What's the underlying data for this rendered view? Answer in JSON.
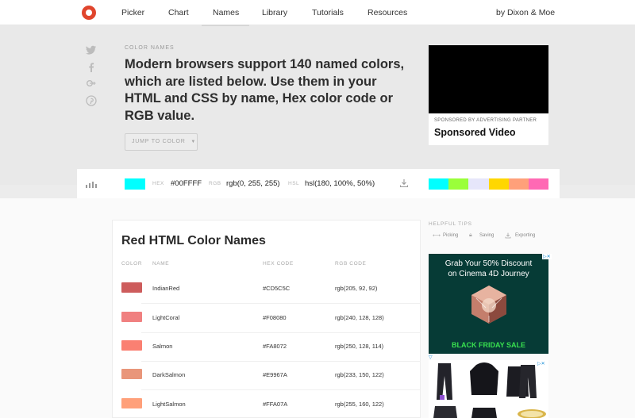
{
  "nav": {
    "items": [
      "Picker",
      "Chart",
      "Names",
      "Library",
      "Tutorials",
      "Resources"
    ],
    "active": "Names",
    "byline": "by Dixon & Moe"
  },
  "hero": {
    "eyebrow": "COLOR NAMES",
    "headline": "Modern browsers support 140 named colors, which are listed below. Use them in your HTML and CSS by name, Hex color code or RGB value.",
    "jump_label": "JUMP TO COLOR",
    "share_icons": [
      "twitter-icon",
      "facebook-icon",
      "google-plus-icon",
      "pinterest-icon"
    ]
  },
  "ad_video": {
    "sponsor_line": "SPONSORED BY ADVERTISING PARTNER",
    "title": "Sponsored Video"
  },
  "colorbar": {
    "swatch": "#00FFFF",
    "hex_label": "HEX",
    "hex_value": "#00FFFF",
    "rgb_label": "RGB",
    "rgb_value": "rgb(0, 255, 255)",
    "hsl_label": "HSL",
    "hsl_value": "hsl(180, 100%, 50%)",
    "palette": [
      "#00FFFF",
      "#9AFF3A",
      "#E6E6FA",
      "#FFD700",
      "#FFA07A",
      "#FF69B4"
    ]
  },
  "table": {
    "title": "Red HTML Color Names",
    "headers": [
      "COLOR",
      "NAME",
      "HEX CODE",
      "RGB CODE"
    ],
    "rows": [
      {
        "name": "IndianRed",
        "hex": "#CD5C5C",
        "rgb": "rgb(205, 92, 92)",
        "color": "#CD5C5C"
      },
      {
        "name": "LightCoral",
        "hex": "#F08080",
        "rgb": "rgb(240, 128, 128)",
        "color": "#F08080"
      },
      {
        "name": "Salmon",
        "hex": "#FA8072",
        "rgb": "rgb(250, 128, 114)",
        "color": "#FA8072"
      },
      {
        "name": "DarkSalmon",
        "hex": "#E9967A",
        "rgb": "rgb(233, 150, 122)",
        "color": "#E9967A"
      },
      {
        "name": "LightSalmon",
        "hex": "#FFA07A",
        "rgb": "rgb(255, 160, 122)",
        "color": "#FFA07A"
      }
    ]
  },
  "tips": {
    "title": "HELPFUL TIPS",
    "items": [
      "Picking",
      "Saving",
      "Exporting"
    ]
  },
  "ad_cinema": {
    "copy_line1": "Grab Your 50% Discount",
    "copy_line2": "on Cinema 4D Journey",
    "cta": "BLACK FRIDAY SALE"
  },
  "colors": {
    "brand": "#E0452D",
    "cinema_bg": "#063B36",
    "cinema_cta": "#38E04F"
  }
}
